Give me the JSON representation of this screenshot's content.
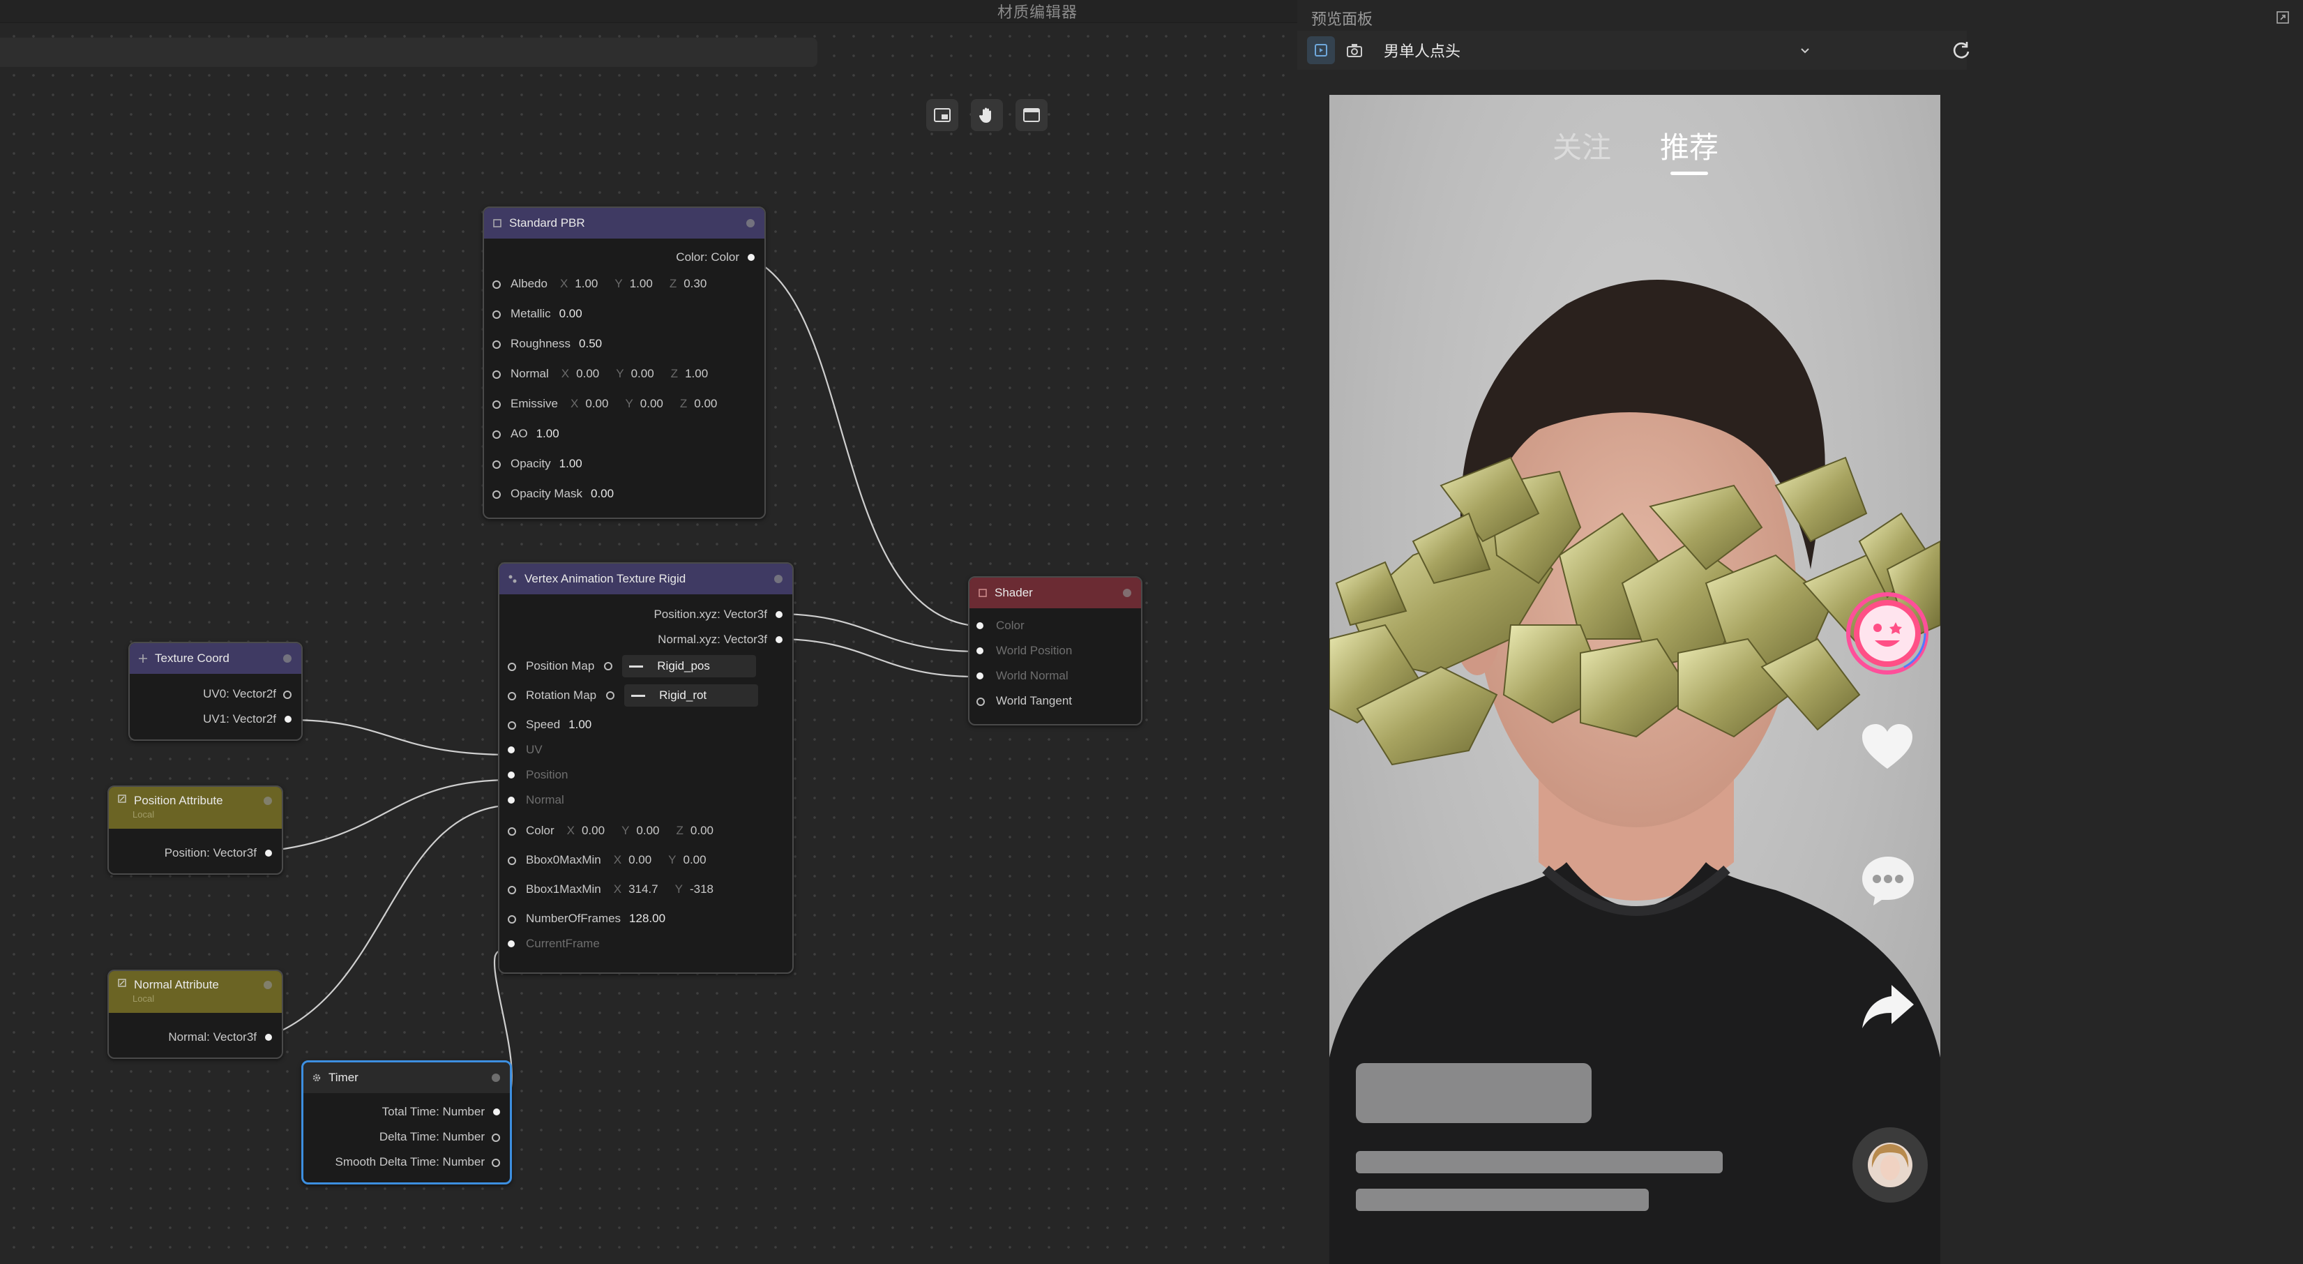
{
  "editor": {
    "title": "材质编辑器",
    "toolbar": [
      "preview-window-icon",
      "hand-icon",
      "window-icon"
    ]
  },
  "nodes": {
    "standard_pbr": {
      "title": "Standard PBR",
      "output": "Color: Color",
      "rows": [
        {
          "label": "Albedo",
          "axes": [
            "X",
            "Y",
            "Z"
          ],
          "values": [
            "1.00",
            "1.00",
            "0.30"
          ]
        },
        {
          "label": "Metallic",
          "values": [
            "0.00"
          ]
        },
        {
          "label": "Roughness",
          "values": [
            "0.50"
          ]
        },
        {
          "label": "Normal",
          "axes": [
            "X",
            "Y",
            "Z"
          ],
          "values": [
            "0.00",
            "0.00",
            "1.00"
          ]
        },
        {
          "label": "Emissive",
          "axes": [
            "X",
            "Y",
            "Z"
          ],
          "values": [
            "0.00",
            "0.00",
            "0.00"
          ]
        },
        {
          "label": "AO",
          "values": [
            "1.00"
          ]
        },
        {
          "label": "Opacity",
          "values": [
            "1.00"
          ]
        },
        {
          "label": "Opacity Mask",
          "values": [
            "0.00"
          ]
        }
      ]
    },
    "vat": {
      "title": "Vertex Animation Texture Rigid",
      "outputs": [
        "Position.xyz: Vector3f",
        "Normal.xyz: Vector3f"
      ],
      "position_map": {
        "label": "Position Map",
        "texture": "Rigid_pos"
      },
      "rotation_map": {
        "label": "Rotation Map",
        "texture": "Rigid_rot"
      },
      "speed": {
        "label": "Speed",
        "value": "1.00"
      },
      "uv": "UV",
      "position": "Position",
      "normal": "Normal",
      "color": {
        "label": "Color",
        "axes": [
          "X",
          "Y",
          "Z"
        ],
        "values": [
          "0.00",
          "0.00",
          "0.00"
        ]
      },
      "bbox0": {
        "label": "Bbox0MaxMin",
        "axes": [
          "X",
          "Y"
        ],
        "values": [
          "0.00",
          "0.00"
        ]
      },
      "bbox1": {
        "label": "Bbox1MaxMin",
        "axes": [
          "X",
          "Y"
        ],
        "values": [
          "314.7",
          "-318"
        ]
      },
      "frames": {
        "label": "NumberOfFrames",
        "value": "128.00"
      },
      "current_frame": "CurrentFrame"
    },
    "shader": {
      "title": "Shader",
      "inputs": [
        "Color",
        "World Position",
        "World Normal",
        "World Tangent"
      ]
    },
    "texture_coord": {
      "title": "Texture Coord",
      "outputs": [
        "UV0: Vector2f",
        "UV1: Vector2f"
      ]
    },
    "position_attr": {
      "title": "Position Attribute",
      "subtitle": "Local",
      "output": "Position: Vector3f"
    },
    "normal_attr": {
      "title": "Normal Attribute",
      "subtitle": "Local",
      "output": "Normal: Vector3f"
    },
    "timer": {
      "title": "Timer",
      "outputs": [
        "Total Time: Number",
        "Delta Time: Number",
        "Smooth Delta Time: Number"
      ]
    }
  },
  "preview": {
    "title": "预览面板",
    "model_select": "男单人点头",
    "tabs": {
      "follow": "关注",
      "recommend": "推荐"
    },
    "colors": {
      "header_standard": "#3f3a63",
      "header_vat": "#3f3a63",
      "header_shader": "#6b2b33",
      "header_attr": "#6b6424",
      "selected_border": "#3d8fe0"
    }
  }
}
